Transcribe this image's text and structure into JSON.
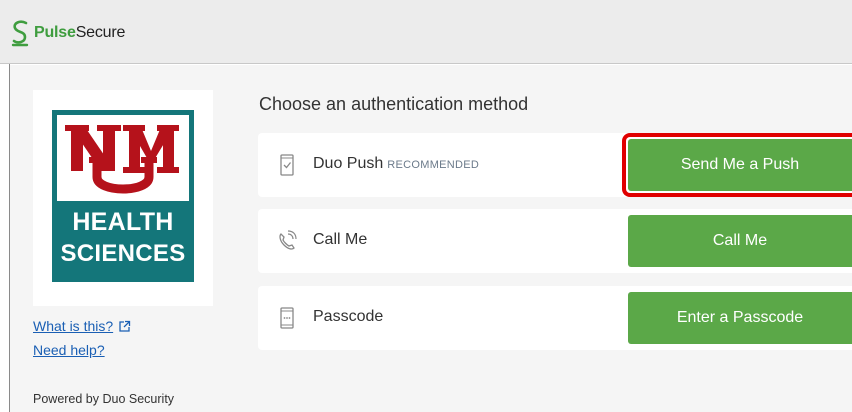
{
  "titlebar": {
    "brand_pulse": "Pulse",
    "brand_secure": "Secure"
  },
  "logo": {
    "line1": "HEALTH",
    "line2": "SCIENCES"
  },
  "links": {
    "what_is_this": "What is this?",
    "need_help": "Need help?",
    "powered_by": "Powered by Duo Security"
  },
  "main": {
    "heading": "Choose an authentication method",
    "methods": [
      {
        "label": "Duo Push",
        "tag": "RECOMMENDED",
        "button": "Send Me a Push",
        "icon": "phone-check-icon"
      },
      {
        "label": "Call Me",
        "tag": "",
        "button": "Call Me",
        "icon": "phone-call-icon"
      },
      {
        "label": "Passcode",
        "tag": "",
        "button": "Enter a Passcode",
        "icon": "passcode-device-icon"
      }
    ]
  },
  "colors": {
    "accent_green": "#5ba848",
    "logo_teal": "#14767a",
    "logo_red": "#b5121b",
    "highlight_red": "#e00000",
    "link_blue": "#1a5fb4"
  }
}
